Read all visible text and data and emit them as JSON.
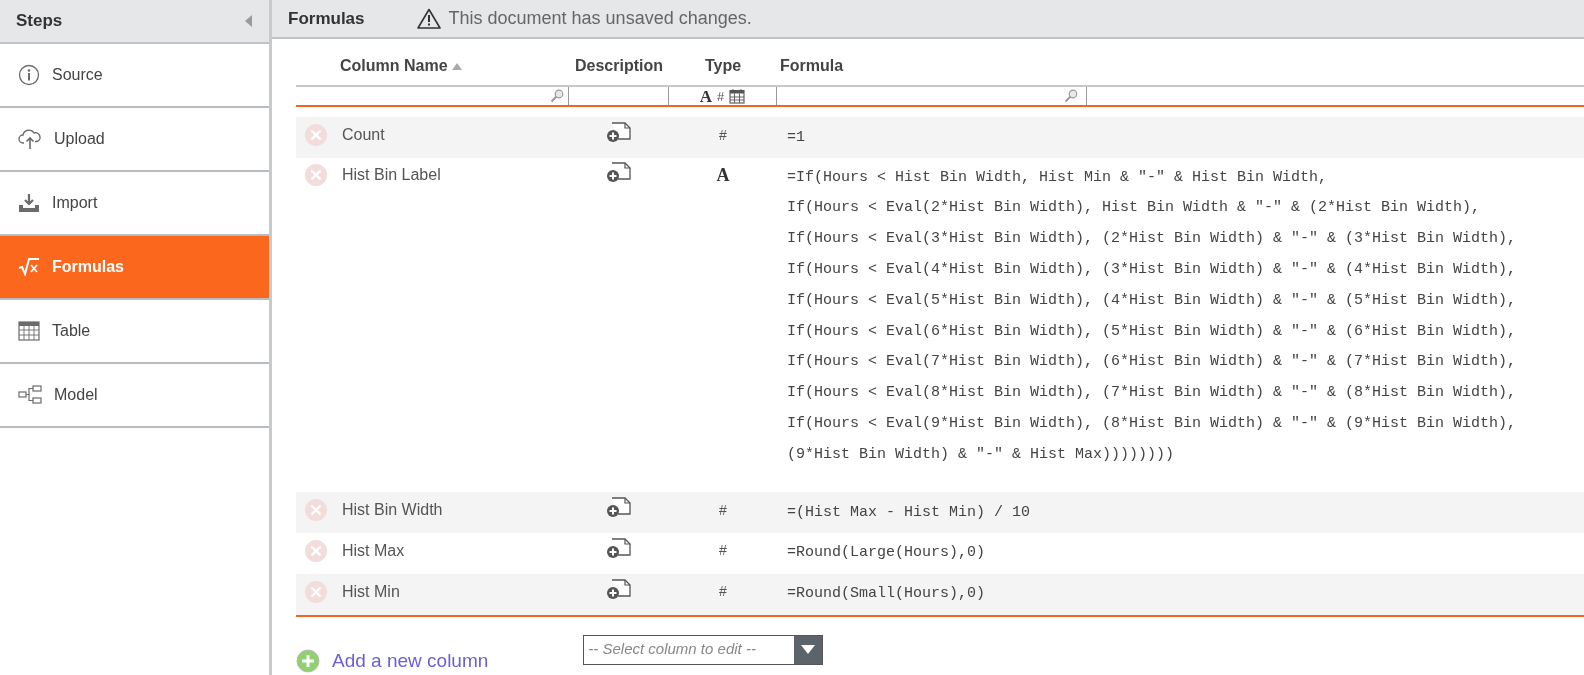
{
  "sidebar": {
    "title": "Steps",
    "items": [
      {
        "label": "Source",
        "selected": false
      },
      {
        "label": "Upload",
        "selected": false
      },
      {
        "label": "Import",
        "selected": false
      },
      {
        "label": "Formulas",
        "selected": true
      },
      {
        "label": "Table",
        "selected": false
      },
      {
        "label": "Model",
        "selected": false
      }
    ]
  },
  "header": {
    "title": "Formulas",
    "warning": "This document has unsaved changes."
  },
  "table": {
    "columns": [
      "Column Name",
      "Description",
      "Type",
      "Formula"
    ],
    "type_filter": [
      "A",
      "#"
    ],
    "rows": [
      {
        "name": "Count",
        "type": "#",
        "formula": [
          "=1"
        ]
      },
      {
        "name": "Hist Bin Label",
        "type": "A",
        "formula": [
          "=If(Hours < Hist Bin Width, Hist Min & \"-\" & Hist Bin Width,",
          "If(Hours < Eval(2*Hist Bin Width), Hist Bin Width & \"-\" & (2*Hist Bin Width),",
          "If(Hours < Eval(3*Hist Bin Width), (2*Hist Bin Width) & \"-\" & (3*Hist Bin Width),",
          "If(Hours < Eval(4*Hist Bin Width), (3*Hist Bin Width) & \"-\" & (4*Hist Bin Width),",
          "If(Hours < Eval(5*Hist Bin Width), (4*Hist Bin Width) & \"-\" & (5*Hist Bin Width),",
          "If(Hours < Eval(6*Hist Bin Width), (5*Hist Bin Width) & \"-\" & (6*Hist Bin Width),",
          "If(Hours < Eval(7*Hist Bin Width), (6*Hist Bin Width) & \"-\" & (7*Hist Bin Width),",
          "If(Hours < Eval(8*Hist Bin Width), (7*Hist Bin Width) & \"-\" & (8*Hist Bin Width),",
          "If(Hours < Eval(9*Hist Bin Width), (8*Hist Bin Width) & \"-\" & (9*Hist Bin Width),",
          "(9*Hist Bin Width) & \"-\" & Hist Max))))))))"
        ]
      },
      {
        "name": "Hist Bin Width",
        "type": "#",
        "formula": [
          "=(Hist Max - Hist Min) / 10"
        ]
      },
      {
        "name": "Hist Max",
        "type": "#",
        "formula": [
          "=Round(Large(Hours),0)"
        ]
      },
      {
        "name": "Hist Min",
        "type": "#",
        "formula": [
          "=Round(Small(Hours),0)"
        ]
      }
    ]
  },
  "add_column": "Add a new column",
  "column_select": {
    "placeholder": "-- Select column to edit --"
  }
}
